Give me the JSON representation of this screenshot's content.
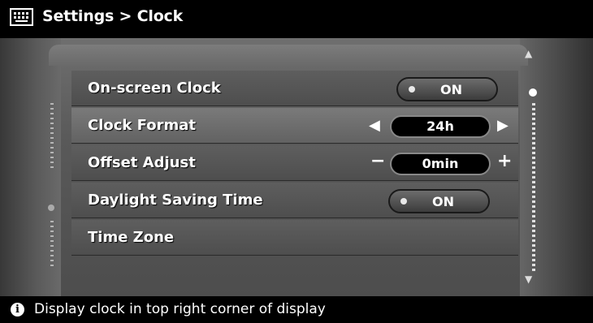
{
  "header": {
    "icon": "settings-keyboard-icon",
    "title": "Settings > Clock"
  },
  "menu": {
    "items": [
      {
        "label": "On-screen Clock",
        "control": "toggle",
        "value": "ON"
      },
      {
        "label": "Clock Format",
        "control": "selector",
        "value": "24h",
        "left_icon": "triangle-left-icon",
        "right_icon": "triangle-right-icon"
      },
      {
        "label": "Offset Adjust",
        "control": "stepper",
        "value": "0min",
        "left_icon": "minus-icon",
        "right_icon": "plus-icon",
        "left_symbol": "−",
        "right_symbol": "+"
      },
      {
        "label": "Daylight Saving Time",
        "control": "toggle",
        "value": "ON"
      },
      {
        "label": "Time Zone",
        "control": "none"
      }
    ]
  },
  "status": {
    "icon": "info-icon",
    "text": "Display clock in top right corner of display"
  },
  "colors": {
    "background": "#000000",
    "panel": "#5a5a5a",
    "text": "#ffffff"
  }
}
